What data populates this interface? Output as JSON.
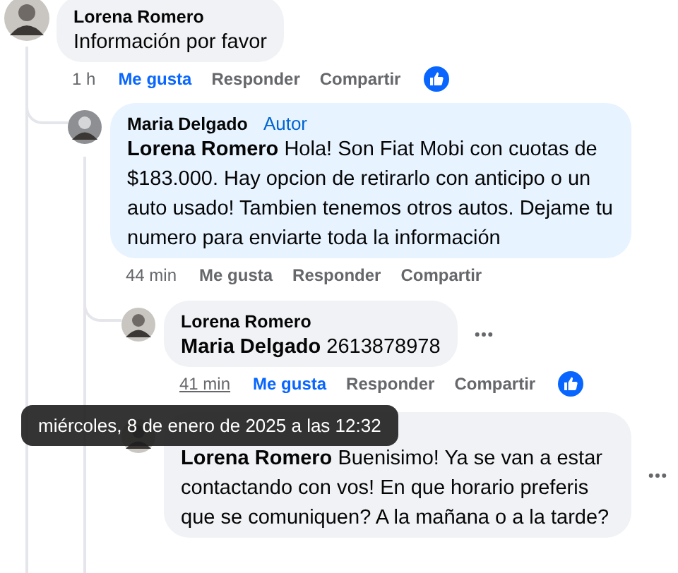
{
  "comments": [
    {
      "author": "Lorena Romero",
      "body": "Información por favor",
      "time": "1 h",
      "time_hovered": false,
      "liked": true,
      "menu_visible": false,
      "actions": [
        "Me gusta",
        "Responder",
        "Compartir"
      ],
      "replies": [
        {
          "author": "Maria Delgado",
          "badge": "Autor",
          "body": "**Lorena Romero** Hola! Son Fiat Mobi con cuotas de $183.000. Hay opcion de retirarlo con anticipo o un auto usado! Tambien tenemos otros autos. Dejame tu numero para enviarte toda la información",
          "time": "44 min",
          "time_hovered": false,
          "liked": false,
          "menu_visible": false,
          "actions": [
            "Me gusta",
            "Responder",
            "Compartir"
          ],
          "replies": [
            {
              "author": "Lorena Romero",
              "body": "**Maria Delgado** 2613878978",
              "time": "41 min",
              "time_hovered": true,
              "liked": true,
              "menu_visible": true,
              "actions": [
                "Me gusta",
                "Responder",
                "Compartir"
              ]
            },
            {
              "body": "**Lorena Romero** Buenisimo! Ya se van a estar contactando con vos! En que horario preferis que se comuniquen? A la mañana o a la tarde?",
              "menu_visible": true
            }
          ]
        }
      ]
    }
  ],
  "tooltip": {
    "text": "miércoles, 8 de enero de 2025 a las 12:32"
  }
}
